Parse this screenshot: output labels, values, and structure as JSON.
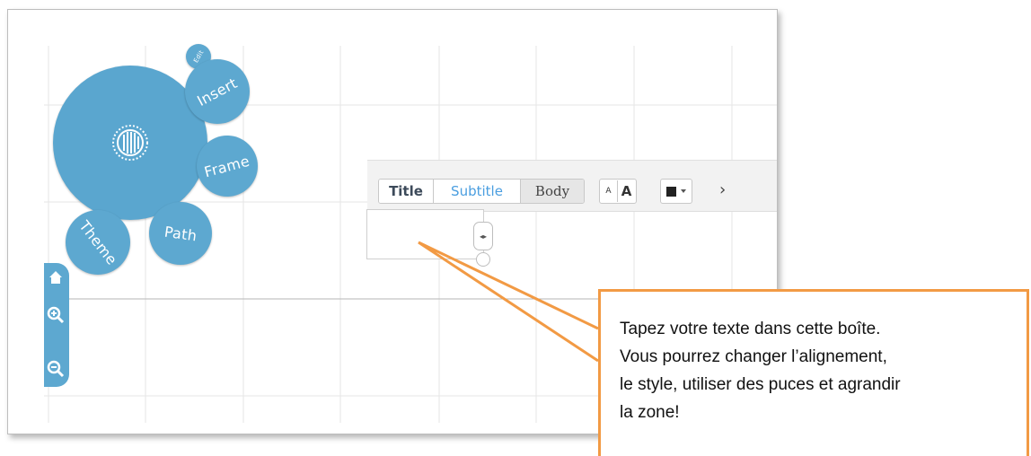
{
  "canvas": {
    "bubbles": {
      "top_label": "Edit",
      "insert_label": "Insert",
      "frame_label": "Frame",
      "path_label": "Path",
      "theme_label": "Theme"
    }
  },
  "sidebar": {
    "items": [
      {
        "icon": "home-icon"
      },
      {
        "icon": "zoom-in-icon"
      },
      {
        "icon": "zoom-out-icon"
      }
    ]
  },
  "text_toolbar": {
    "title_label": "Title",
    "subtitle_label": "Subtitle",
    "body_label": "Body",
    "font_smaller_label": "A",
    "font_larger_label": "A",
    "more_label": "›"
  },
  "callout": {
    "lines": [
      "Tapez votre texte dans cette boîte.",
      "Vous pourrez changer l’alignement,",
      "le style, utiliser des puces et agrandir",
      "la zone!"
    ]
  },
  "colors": {
    "bubble": "#5da8d0",
    "callout_border": "#f29a44",
    "subtitle_accent": "#4a9ee0"
  }
}
